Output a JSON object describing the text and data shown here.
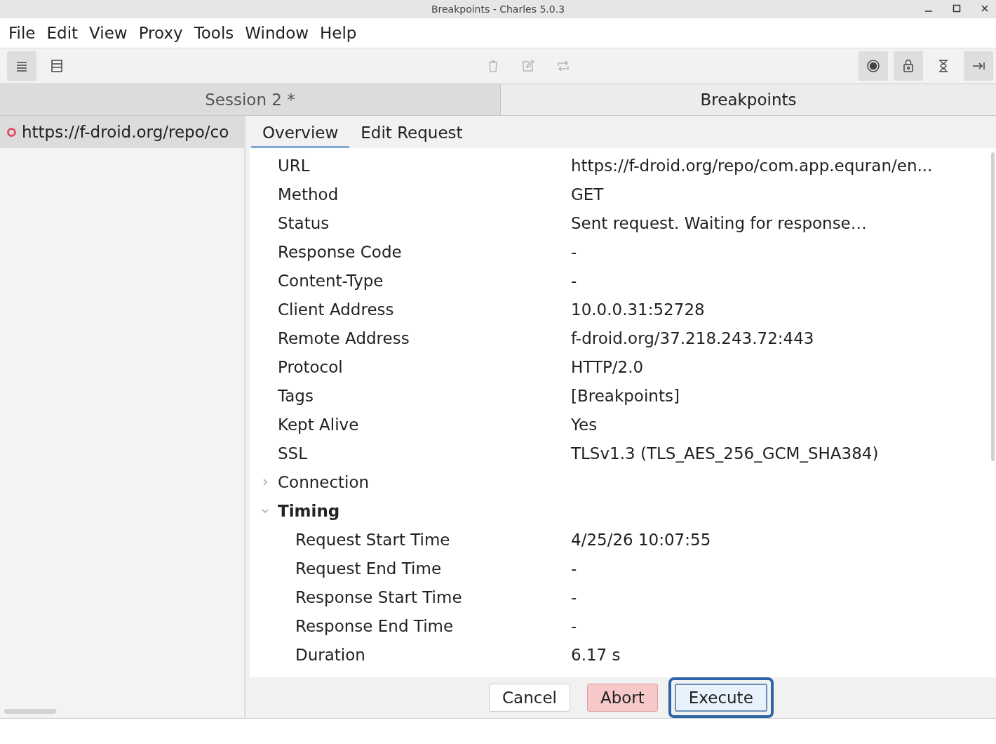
{
  "window": {
    "title": "Breakpoints - Charles 5.0.3"
  },
  "menu": [
    "File",
    "Edit",
    "View",
    "Proxy",
    "Tools",
    "Window",
    "Help"
  ],
  "toolbar": [
    {
      "pressed": true,
      "disabled": false
    },
    {
      "pressed": false,
      "disabled": false
    },
    {
      "pressed": false,
      "disabled": true
    },
    {
      "pressed": false,
      "disabled": true
    },
    {
      "pressed": false,
      "disabled": true
    },
    {
      "pressed": true,
      "disabled": false
    },
    {
      "pressed": true,
      "disabled": false
    },
    {
      "pressed": false,
      "disabled": false
    },
    {
      "pressed": true,
      "disabled": false
    }
  ],
  "tabs": [
    {
      "label": "Session 2 *",
      "selected": false
    },
    {
      "label": "Breakpoints",
      "selected": true
    }
  ],
  "sidebar": {
    "items": [
      {
        "label": "https://f-droid.org/repo/co",
        "color": "#e0506a"
      }
    ]
  },
  "subtabs": [
    {
      "label": "Overview",
      "selected": true
    },
    {
      "label": "Edit Request",
      "selected": false
    }
  ],
  "overview": [
    {
      "kind": "field",
      "name": "URL",
      "value": "https://f-droid.org/repo/com.app.equran/en..."
    },
    {
      "kind": "field",
      "name": "Method",
      "value": "GET"
    },
    {
      "kind": "field",
      "name": "Status",
      "value": "Sent request. Waiting for response…"
    },
    {
      "kind": "field",
      "name": "Response Code",
      "value": "-"
    },
    {
      "kind": "field",
      "name": "Content-Type",
      "value": "-"
    },
    {
      "kind": "field",
      "name": "Client Address",
      "value": "10.0.0.31:52728"
    },
    {
      "kind": "field",
      "name": "Remote Address",
      "value": "f-droid.org/37.218.243.72:443"
    },
    {
      "kind": "field",
      "name": "Protocol",
      "value": "HTTP/2.0"
    },
    {
      "kind": "field",
      "name": "Tags",
      "value": "[Breakpoints]"
    },
    {
      "kind": "field",
      "name": "Kept Alive",
      "value": "Yes"
    },
    {
      "kind": "field",
      "name": "SSL",
      "value": "TLSv1.3 (TLS_AES_256_GCM_SHA384)"
    },
    {
      "kind": "group",
      "name": "Connection",
      "expanded": false
    },
    {
      "kind": "group",
      "name": "Timing",
      "expanded": true,
      "children": [
        {
          "kind": "field",
          "name": "Request Start Time",
          "value": "4/25/26 10:07:55"
        },
        {
          "kind": "field",
          "name": "Request End Time",
          "value": "-"
        },
        {
          "kind": "field",
          "name": "Response Start Time",
          "value": "-"
        },
        {
          "kind": "field",
          "name": "Response End Time",
          "value": "-"
        },
        {
          "kind": "field",
          "name": "Duration",
          "value": "6.17 s"
        }
      ]
    }
  ],
  "buttons": [
    {
      "label": "Cancel",
      "kind": "plain",
      "focused": false
    },
    {
      "label": "Abort",
      "kind": "danger",
      "focused": false
    },
    {
      "label": "Execute",
      "kind": "plain",
      "focused": true
    }
  ]
}
